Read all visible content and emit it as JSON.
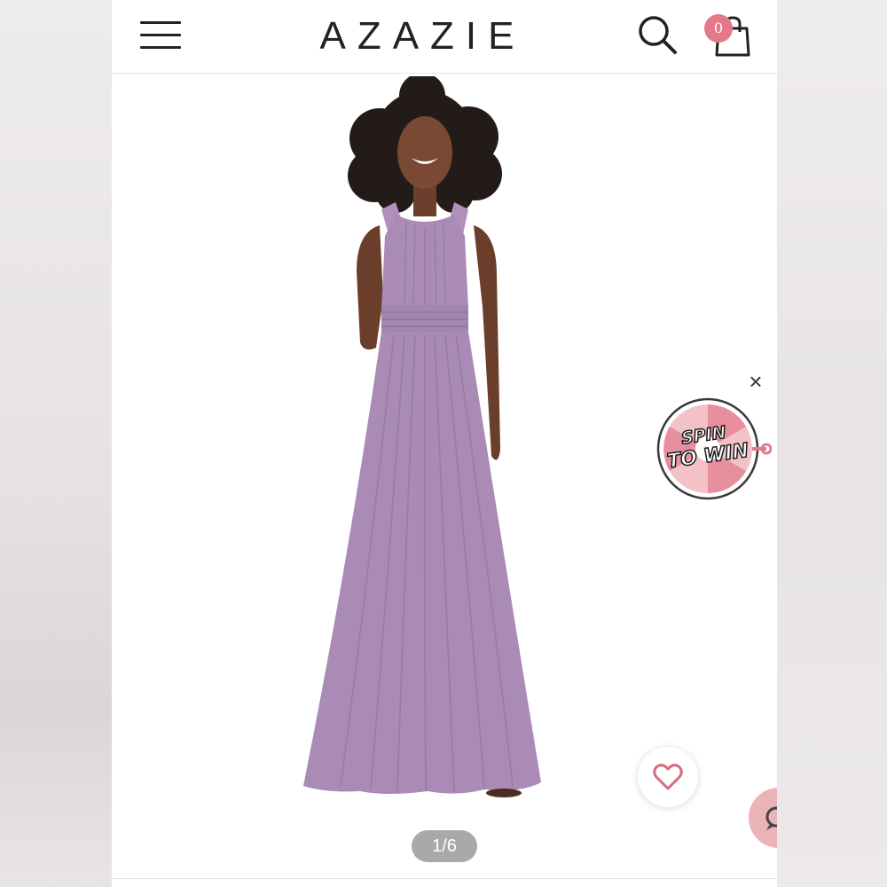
{
  "header": {
    "brand": "AZAZIE",
    "menu_icon": "hamburger-menu-icon",
    "search_icon": "search-icon",
    "bag_icon": "shopping-bag-icon",
    "bag_count": "0"
  },
  "product": {
    "image": "model-in-long-mauve-chiffon-dress",
    "dress_color": "#a98bb5",
    "pager": "1/6"
  },
  "promo": {
    "close_icon": "close-icon",
    "line1": "SPIN",
    "line2": "TO WIN"
  },
  "actions": {
    "wishlist_icon": "heart-icon",
    "chat_icon": "chat-icon"
  },
  "colors": {
    "accent": "#e4798a",
    "chat": "#e9b3b7",
    "pager_bg": "#a9a9a9"
  }
}
